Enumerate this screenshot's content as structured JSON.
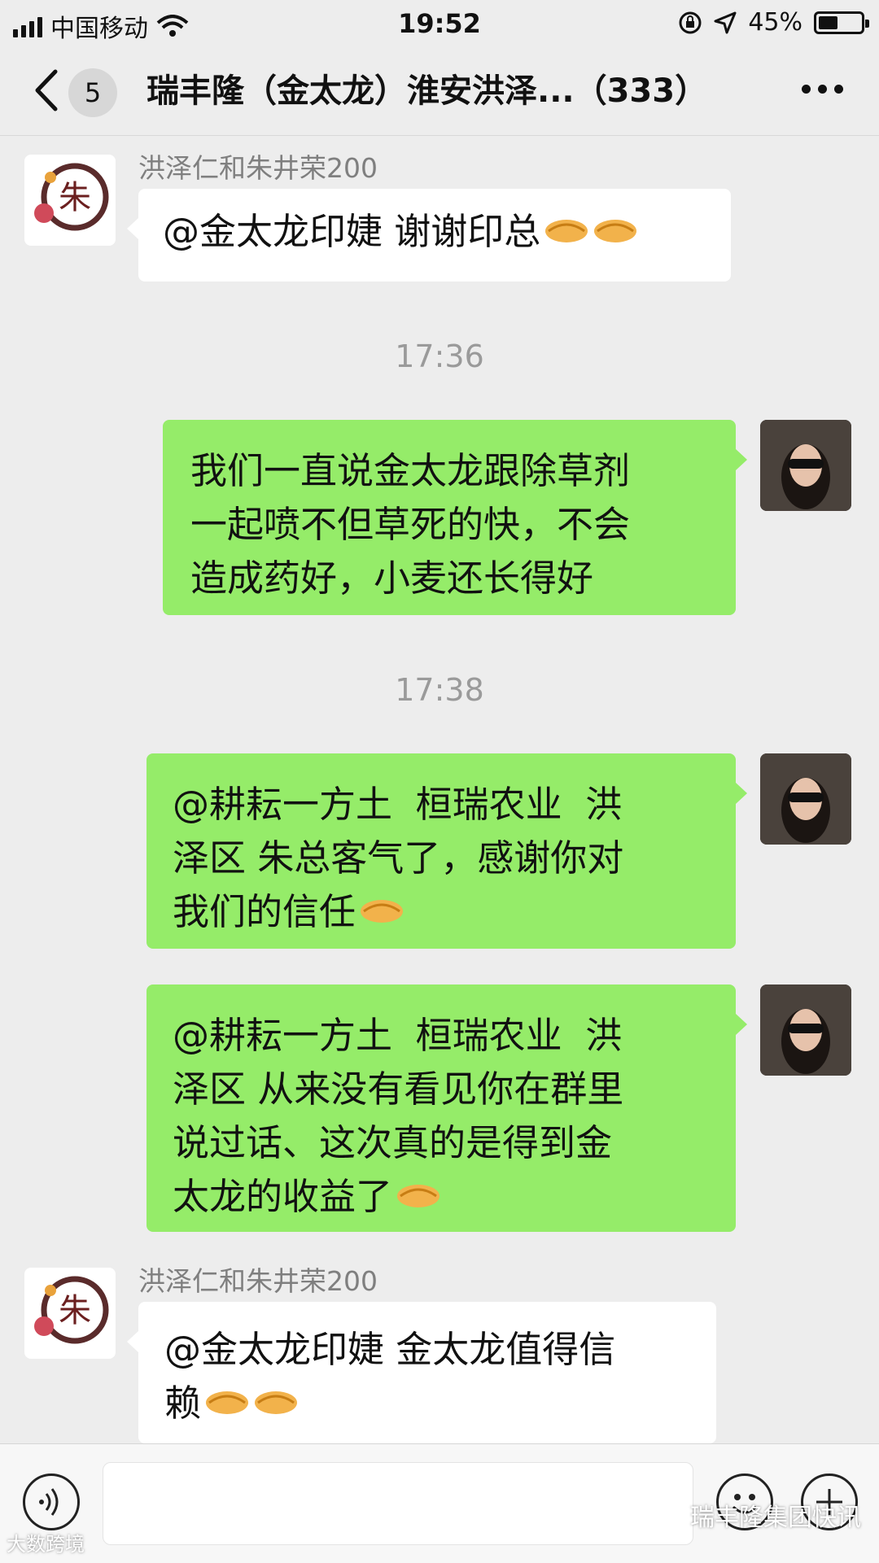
{
  "status_bar": {
    "carrier": "中国移动",
    "time": "19:52",
    "battery_percent_text": "45%",
    "battery_level": 0.45
  },
  "nav": {
    "unread_count": "5",
    "title": "瑞丰隆（金太龙）淮安洪泽...（333）"
  },
  "messages": [
    {
      "side": "left",
      "sender": "洪泽仁和朱井荣200",
      "text": "@金太龙印婕 谢谢印总",
      "emoji_count": 2
    },
    {
      "type": "time",
      "text": "17:36"
    },
    {
      "side": "right",
      "lines": [
        "我们一直说金太龙跟除草剂",
        "一起喷不但草死的快，不会",
        "造成药好，小麦还长得好"
      ]
    },
    {
      "type": "time",
      "text": "17:38"
    },
    {
      "side": "right",
      "lines": [
        "@耕耘一方土  桓瑞农业  洪",
        "泽区 朱总客气了，感谢你对",
        "我们的信任"
      ],
      "emoji_count": 1
    },
    {
      "side": "right",
      "lines": [
        "@耕耘一方土  桓瑞农业  洪",
        "泽区 从来没有看见你在群里",
        "说过话、这次真的是得到金",
        "太龙的收益了"
      ],
      "emoji_count": 1
    },
    {
      "side": "left",
      "sender": "洪泽仁和朱井荣200",
      "lines": [
        "@金太龙印婕 金太龙值得信",
        "赖"
      ],
      "emoji_count": 2
    }
  ],
  "watermark": {
    "right_text": "瑞丰隆集团快讯",
    "left_text": "大数跨境"
  },
  "icons": [
    "signal-icon",
    "wifi-icon",
    "lock-rotation-icon",
    "location-icon",
    "battery-icon",
    "back-icon",
    "more-icon",
    "voice-icon",
    "emoji-icon",
    "plus-icon",
    "handshake-emoji"
  ],
  "colors": {
    "background": "#ededed",
    "bubble_green": "#95ec69",
    "bubble_white": "#ffffff"
  }
}
